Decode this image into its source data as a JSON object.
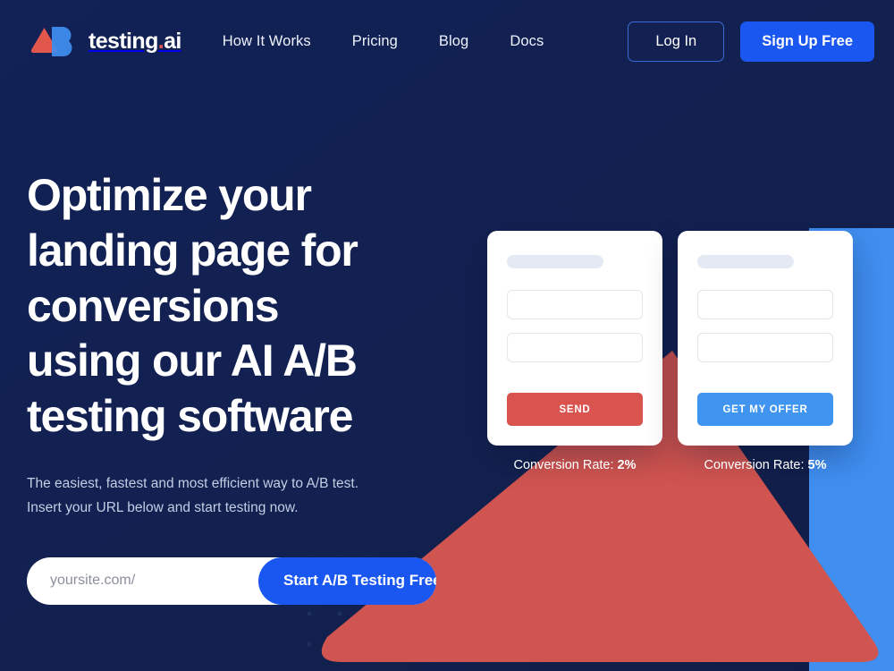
{
  "brand": {
    "name_main": "testing",
    "name_dot": ".",
    "name_tld": "ai",
    "logo_icon": "ab-logo-icon",
    "triangle_color": "#e2574c",
    "b_color": "#3f95ef"
  },
  "nav": {
    "items": [
      {
        "label": "How It Works"
      },
      {
        "label": "Pricing"
      },
      {
        "label": "Blog"
      },
      {
        "label": "Docs"
      }
    ],
    "login_label": "Log In",
    "signup_label": "Sign Up Free"
  },
  "hero": {
    "headline_line1": "Optimize your",
    "headline_line2": "landing page for",
    "headline_line3": "conversions",
    "headline_line4": "using our AI A/B",
    "headline_line5": "testing software",
    "subtitle_line1": "The easiest, fastest and most efficient way to A/B test.",
    "subtitle_line2": "Insert your URL below and start testing now.",
    "url_placeholder": "yoursite.com/",
    "url_value": "",
    "cta_label": "Start A/B Testing Free"
  },
  "variants": [
    {
      "id": "variant-a",
      "button_label": "SEND",
      "button_color": "#d9534f",
      "caption_prefix": "Conversion Rate: ",
      "caption_value": "2%"
    },
    {
      "id": "variant-b",
      "button_label": "GET MY OFFER",
      "button_color": "#3f95ef",
      "caption_prefix": "Conversion Rate: ",
      "caption_value": "5%"
    }
  ],
  "theme": {
    "background": "#122156",
    "accent_blue": "#1a56f0",
    "accent_red": "#d9534f",
    "light_blue": "#3f95ef"
  }
}
